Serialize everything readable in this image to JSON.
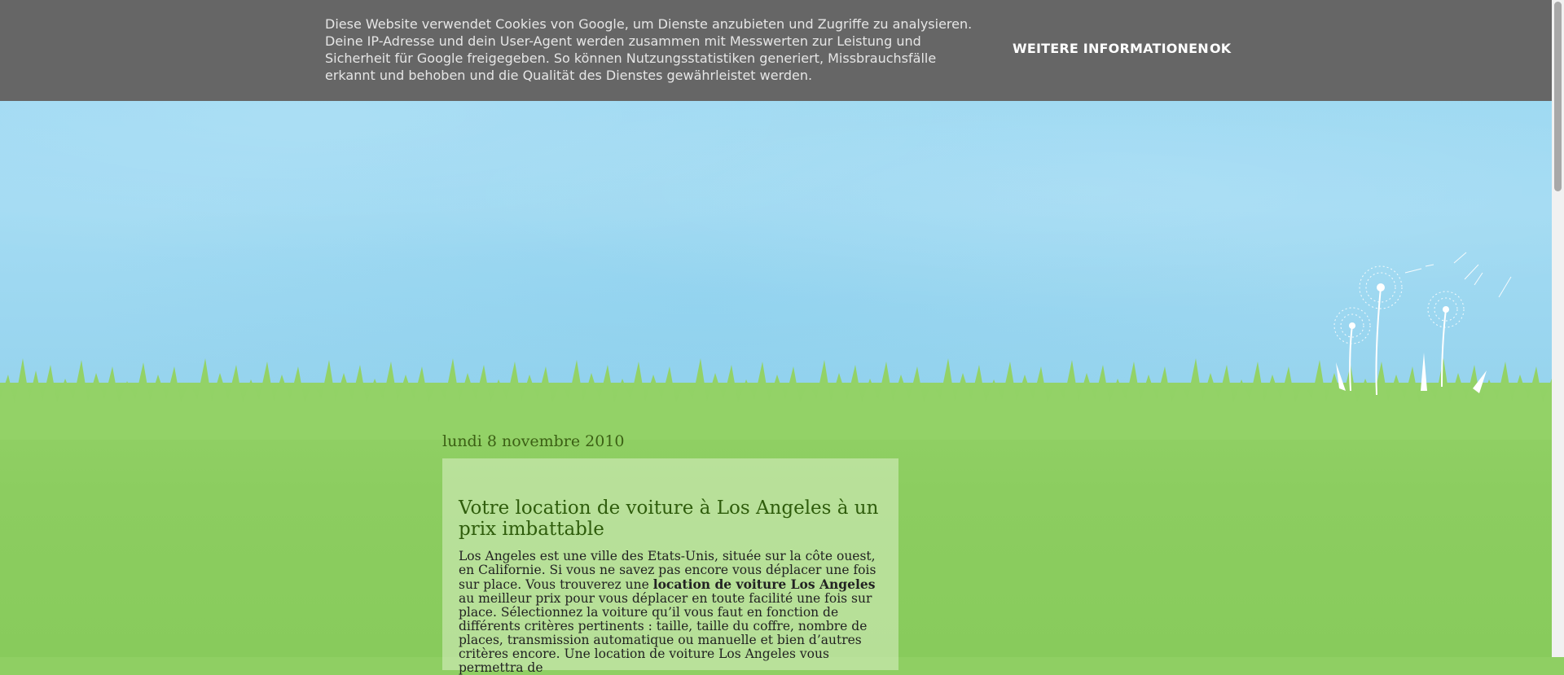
{
  "cookie_notice": {
    "text": "Diese Website verwendet Cookies von Google, um Dienste anzubieten und Zugriffe zu analysieren. Deine IP-Adresse und dein User-Agent werden zusammen mit Messwerten zur Leistung und Sicherheit für Google freigegeben. So können Nutzungsstatistiken generiert, Missbrauchsfälle erkannt und behoben und die Qualität des Dienstes gewährleistet werden.",
    "more_info_label": "WEITERE INFORMATIONEN",
    "ok_label": "OK"
  },
  "blog": {
    "date_header": "lundi 8 novembre 2010",
    "post": {
      "title": "Votre location de voiture à Los Angeles à un prix imbattable",
      "body_part1": "Los Angeles est une ville des Etats-Unis, située sur la côte ouest, en Californie. Si vous ne savez pas encore vous déplacer une fois sur place. Vous trouverez une ",
      "body_bold": "location de voiture Los Angeles",
      "body_part2": " au meilleur prix pour vous déplacer en toute facilité une fois sur place. Sélectionnez la voiture qu’il vous faut en fonction de différents critères pertinents : taille, taille du coffre, nombre de places, transmission automatique ou manuelle et bien d’autres critères encore. Une location de voiture Los Angeles vous permettra de"
    }
  },
  "colors": {
    "cookie_bar": "#666666",
    "sky": "#9ad8f2",
    "grass": "#8ccd60",
    "title": "#2f5d0c"
  }
}
